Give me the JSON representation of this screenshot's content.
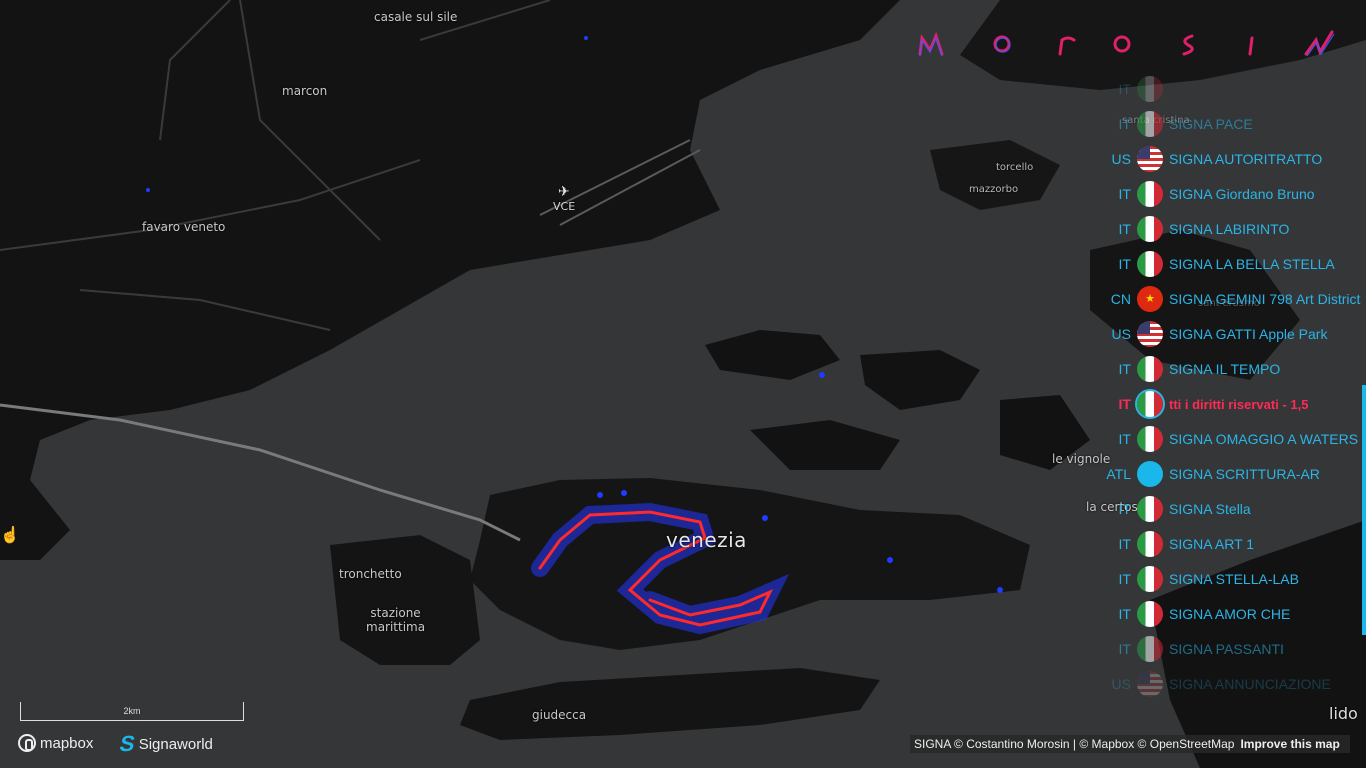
{
  "map": {
    "place_labels": {
      "casale": "casale sul sile",
      "marcon": "marcon",
      "favaro": "favaro veneto",
      "airport_code": "VCE",
      "torcello": "torcello",
      "mazzorbo": "mazzorbo",
      "santa_cristina": "santa cristina",
      "sant_erasmo": "sant'erasmo",
      "le_vignole": "le vignole",
      "la_certosa": "la certosa",
      "venezia": "venezia",
      "tronchetto": "tronchetto",
      "stazione": "stazione\nmarittima",
      "giudecca": "giudecca",
      "lido": "lido"
    },
    "colors": {
      "water": "#343638",
      "land": "#141414",
      "route": "#ff2a2a",
      "route_glow": "#2436ff",
      "accent": "#1ab8ea"
    }
  },
  "brand": {
    "logo_text": "M o r o s i n",
    "mapbox": "mapbox",
    "signaworld": "Signaworld"
  },
  "scale": {
    "label": "2km"
  },
  "artworks": [
    {
      "code": "IT",
      "flag": "it",
      "title": ""
    },
    {
      "code": "IT",
      "flag": "it",
      "title": "SIGNA PACE"
    },
    {
      "code": "US",
      "flag": "us",
      "title": "SIGNA AUTORITRATTO"
    },
    {
      "code": "IT",
      "flag": "it",
      "title": "SIGNA Giordano Bruno"
    },
    {
      "code": "IT",
      "flag": "it",
      "title": "SIGNA LABIRINTO"
    },
    {
      "code": "IT",
      "flag": "it",
      "title": "SIGNA LA BELLA STELLA"
    },
    {
      "code": "CN",
      "flag": "cn",
      "title": "SIGNA GEMINI 798 Art District"
    },
    {
      "code": "US",
      "flag": "us",
      "title": "SIGNA GATTI Apple Park"
    },
    {
      "code": "IT",
      "flag": "it",
      "title": "SIGNA IL TEMPO"
    },
    {
      "code": "IT",
      "flag": "it",
      "title": "tti i diritti riservati - 1,5"
    },
    {
      "code": "IT",
      "flag": "it",
      "title": "SIGNA OMAGGIO A WATERS"
    },
    {
      "code": "ATL",
      "flag": "atl",
      "title": "SIGNA SCRITTURA-AR"
    },
    {
      "code": "IT",
      "flag": "it",
      "title": "SIGNA Stella"
    },
    {
      "code": "IT",
      "flag": "it",
      "title": "SIGNA ART 1"
    },
    {
      "code": "IT",
      "flag": "it",
      "title": "SIGNA STELLA-LAB"
    },
    {
      "code": "IT",
      "flag": "it",
      "title": "SIGNA AMOR CHE"
    },
    {
      "code": "IT",
      "flag": "it",
      "title": "SIGNA PASSANTI"
    },
    {
      "code": "US",
      "flag": "us",
      "title": "SIGNA ANNUNCIAZIONE"
    }
  ],
  "attribution": {
    "text": "SIGNA © Costantino Morosin | © Mapbox © OpenStreetMap",
    "improve": "Improve this map"
  }
}
